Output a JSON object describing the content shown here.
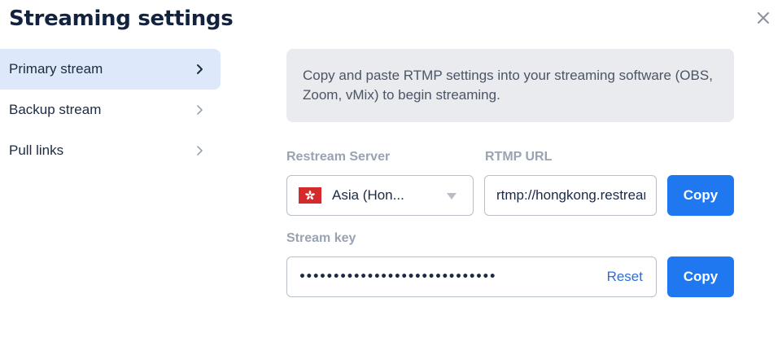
{
  "dialog": {
    "title": "Streaming settings"
  },
  "sidebar": {
    "items": [
      {
        "label": "Primary stream",
        "active": true
      },
      {
        "label": "Backup stream",
        "active": false
      },
      {
        "label": "Pull links",
        "active": false
      }
    ]
  },
  "main": {
    "info_text": "Copy and paste RTMP settings into your streaming software (OBS, Zoom, vMix) to begin streaming.",
    "server": {
      "label": "Restream Server",
      "selected": "Asia (Hon...",
      "flag_icon": "hong-kong-flag-icon"
    },
    "rtmp": {
      "label": "RTMP URL",
      "value": "rtmp://hongkong.restream.io/live",
      "copy_label": "Copy"
    },
    "stream_key": {
      "label": "Stream key",
      "masked_value": "•••••••••••••••••••••••••••••",
      "reset_label": "Reset",
      "copy_label": "Copy"
    }
  },
  "colors": {
    "accent": "#1f78f0",
    "active_item_bg": "#dde9fb",
    "info_bg": "#e9ebef",
    "link": "#2a6fdb"
  }
}
